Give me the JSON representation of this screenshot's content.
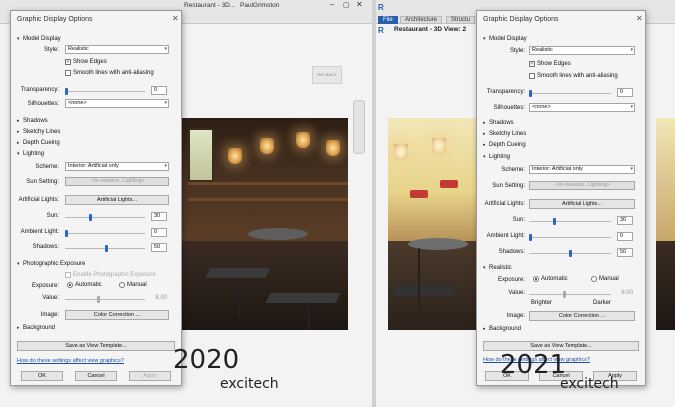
{
  "left": {
    "year_label": "2020",
    "logo": "excitech",
    "topbar": {
      "fragment_1": "Restaurant - 3D...",
      "user": "PaulGrimston"
    },
    "viewcube": {
      "left": "RIG",
      "right": "BACK"
    },
    "dialog": {
      "title": "Graphic Display Options",
      "sections": {
        "model_display": "Model Display",
        "shadows": "Shadows",
        "sketchy_lines": "Sketchy Lines",
        "depth_cueing": "Depth Cueing",
        "lighting": "Lighting",
        "photographic_exposure": "Photographic Exposure",
        "background": "Background"
      },
      "style_label": "Style:",
      "style_value": "Realistic",
      "show_edges": "Show Edges",
      "smooth_lines": "Smooth lines with anti-aliasing",
      "transparency_label": "Transparency:",
      "transparency_value": "0",
      "silhouettes_label": "Silhouettes:",
      "silhouettes_value": "<none>",
      "scheme_label": "Scheme:",
      "scheme_value": "Interior: Artificial only",
      "sun_setting_label": "Sun Setting:",
      "sun_setting_value": "<In-session, Lighting>",
      "artificial_lights_label": "Artificial Lights:",
      "artificial_lights_button": "Artificial Lights...",
      "sun_label": "Sun:",
      "sun_value": "30",
      "ambient_label": "Ambient Light:",
      "ambient_value": "0",
      "shadows_label": "Shadows:",
      "shadows_value": "50",
      "enable_exposure": "Enable Photographic Exposure",
      "exposure_label": "Exposure:",
      "exposure_auto": "Automatic",
      "exposure_manual": "Manual",
      "value_label": "Value:",
      "value_value": "8.00",
      "image_label": "Image:",
      "color_correction": "Color Correction ...",
      "save_template": "Save as View Template...",
      "help_link": "How do these settings affect view graphics?",
      "ok": "OK",
      "cancel": "Cancel",
      "apply": "Apply"
    }
  },
  "right": {
    "year_label": "2021",
    "logo": "excitech",
    "topbar": {
      "file_tab": "File",
      "tab_architecture": "Architecture",
      "tab_structure": "Structu",
      "window_title": "Restaurant - 3D View: 2"
    },
    "dialog": {
      "title": "Graphic Display Options",
      "sections": {
        "model_display": "Model Display",
        "shadows": "Shadows",
        "sketchy_lines": "Sketchy Lines",
        "depth_cueing": "Depth Cueing",
        "lighting": "Lighting",
        "realistic": "Realistic",
        "background": "Background"
      },
      "style_label": "Style:",
      "style_value": "Realistic",
      "show_edges": "Show Edges",
      "smooth_lines": "Smooth lines with anti-aliasing",
      "transparency_label": "Transparency:",
      "transparency_value": "0",
      "silhouettes_label": "Silhouettes:",
      "silhouettes_value": "<none>",
      "scheme_label": "Scheme:",
      "scheme_value": "Interior: Artificial only",
      "sun_setting_label": "Sun Setting:",
      "sun_setting_value": "<In-session, Lighting>",
      "artificial_lights_label": "Artificial Lights:",
      "artificial_lights_button": "Artificial Lights...",
      "sun_label": "Sun:",
      "sun_value": "30",
      "ambient_label": "Ambient Light:",
      "ambient_value": "0",
      "shadows_label": "Shadows:",
      "shadows_value": "50",
      "exposure_label": "Exposure:",
      "exposure_auto": "Automatic",
      "exposure_manual": "Manual",
      "value_label": "Value:",
      "value_value": "8.00",
      "brighter": "Brighter",
      "darker": "Darker",
      "image_label": "Image:",
      "color_correction": "Color Correction ...",
      "save_template": "Save as View Template...",
      "help_link": "How do these settings affect view graphics?",
      "ok": "OK",
      "cancel": "Cancel",
      "apply": "Apply"
    }
  }
}
